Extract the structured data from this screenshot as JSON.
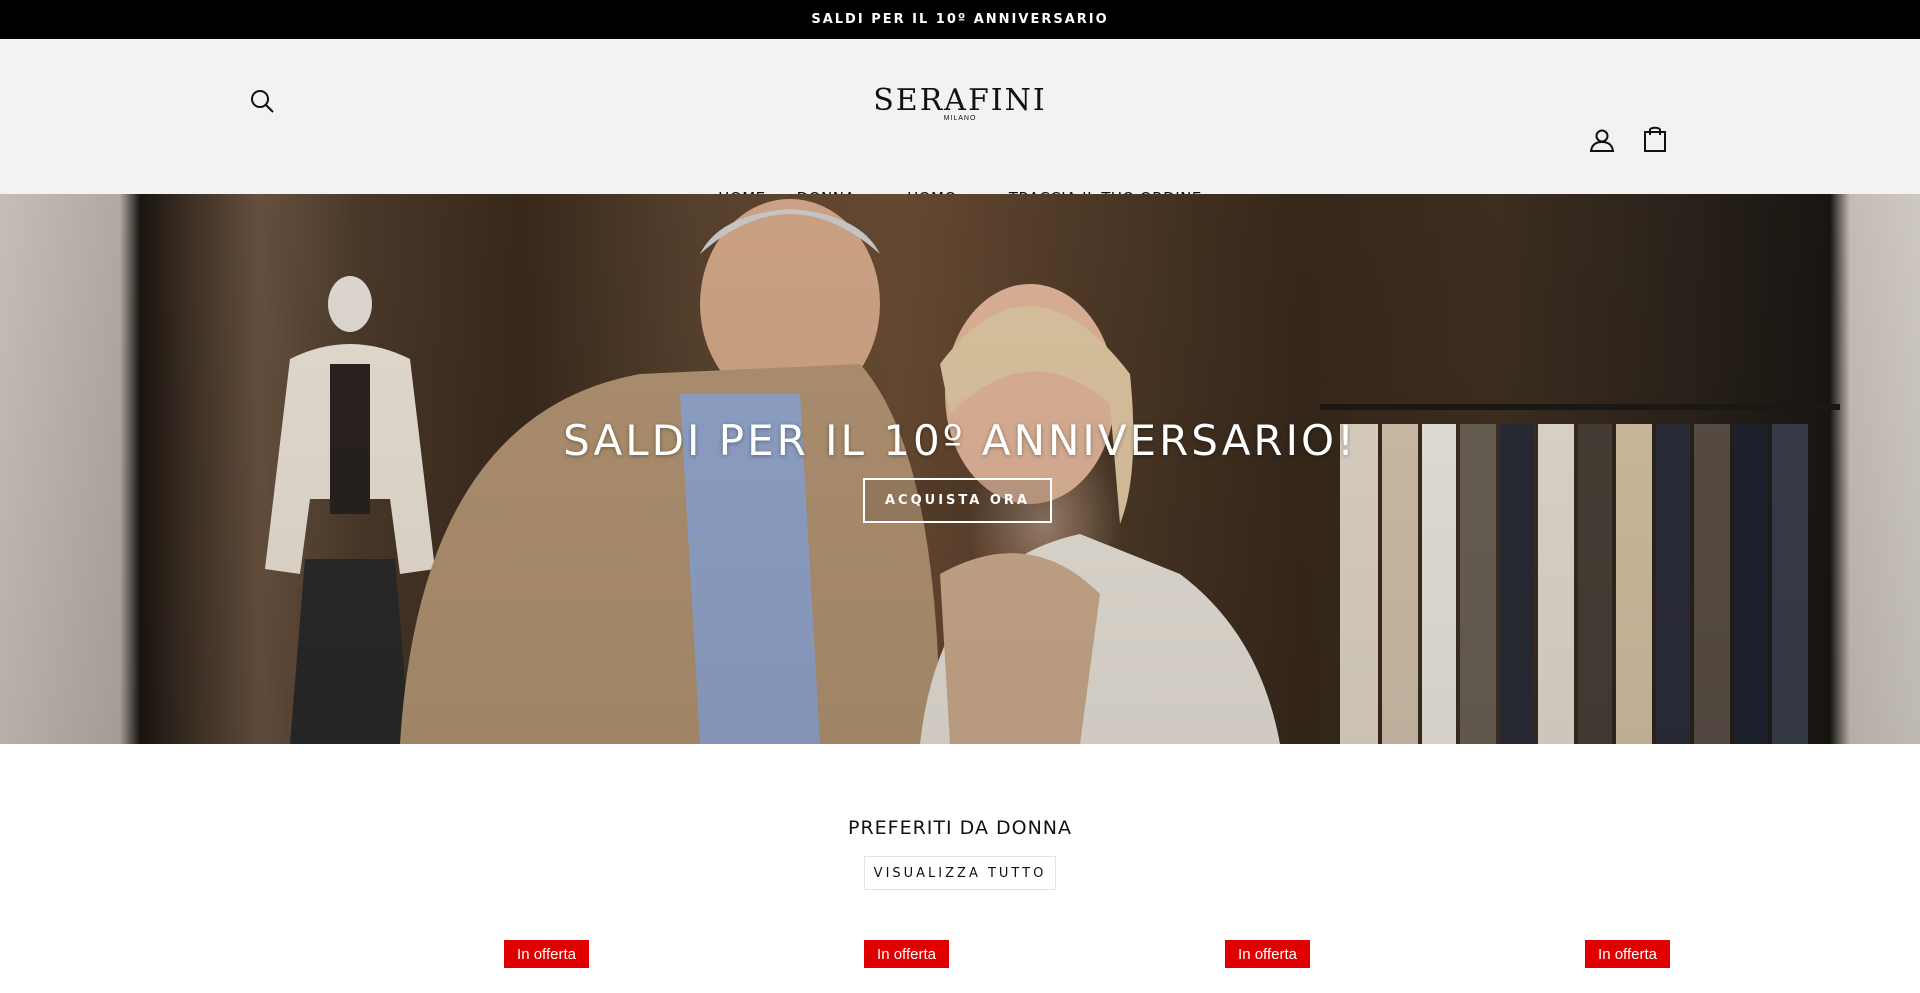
{
  "announcement": {
    "text": "SALDI PER IL 10º ANNIVERSARIO"
  },
  "header": {
    "logo_name": "SERAFINI",
    "logo_sub": "MILANO",
    "search_icon": "search-icon",
    "account_icon": "user-icon",
    "cart_icon": "bag-icon"
  },
  "nav": {
    "items": [
      {
        "label": "HOME",
        "dropdown": false
      },
      {
        "label": "DONNA",
        "dropdown": true
      },
      {
        "label": "UOMO",
        "dropdown": true
      },
      {
        "label": "TRACCIA IL TUO ORDINE",
        "dropdown": false
      }
    ]
  },
  "hero": {
    "title": "SALDI PER IL 10º ANNIVERSARIO!",
    "cta_label": "ACQUISTA ORA"
  },
  "featured": {
    "title": "PREFERITI DA DONNA",
    "view_all_label": "VISUALIZZA TUTTO",
    "badges": [
      "In offerta",
      "In offerta",
      "In offerta",
      "In offerta"
    ]
  },
  "colors": {
    "announcement_bg": "#000000",
    "header_bg": "#f2f2f2",
    "badge_bg": "#e00000"
  }
}
